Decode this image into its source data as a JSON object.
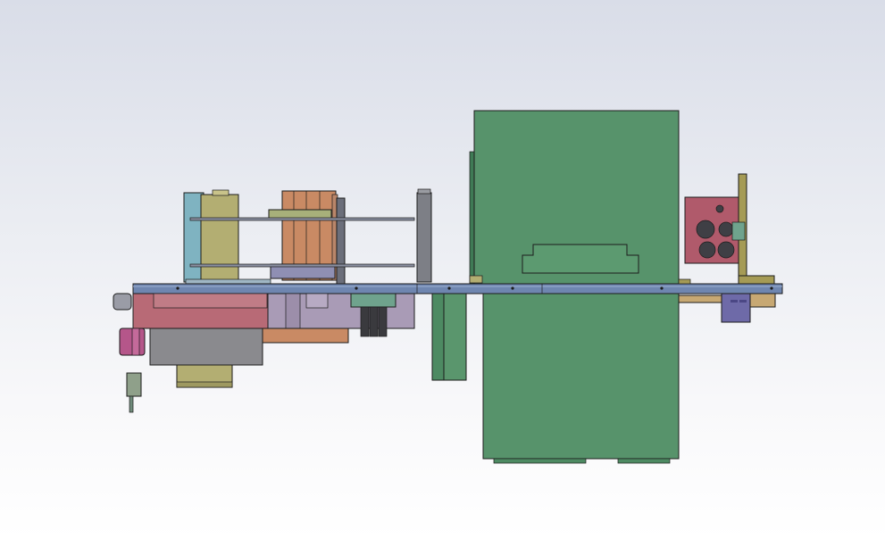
{
  "viewport": {
    "description_free": true,
    "background_top": "#d9dde8",
    "background_bottom": "#ffffff"
  },
  "colors": {
    "cabinet_green": "#57936b",
    "cabinet_green_dark": "#3f7a55",
    "rail_blue": "#6f86b0",
    "rail_blue_dark": "#4c6490",
    "roller_olive": "#b3ae72",
    "roller_teal": "#7fb3c1",
    "roller_copper": "#c98a64",
    "rose_block": "#b86a76",
    "lavender_block": "#a99bb6",
    "gray_block": "#8a8a8e",
    "magenta_part": "#b5568a",
    "bracket_olive": "#a59b55",
    "valve_plate": "#b05a6b",
    "purple_block": "#6e6aa8",
    "rod_gray": "#7d7f86",
    "brass": "#c7a873"
  },
  "icons": [
    "cad-model"
  ]
}
